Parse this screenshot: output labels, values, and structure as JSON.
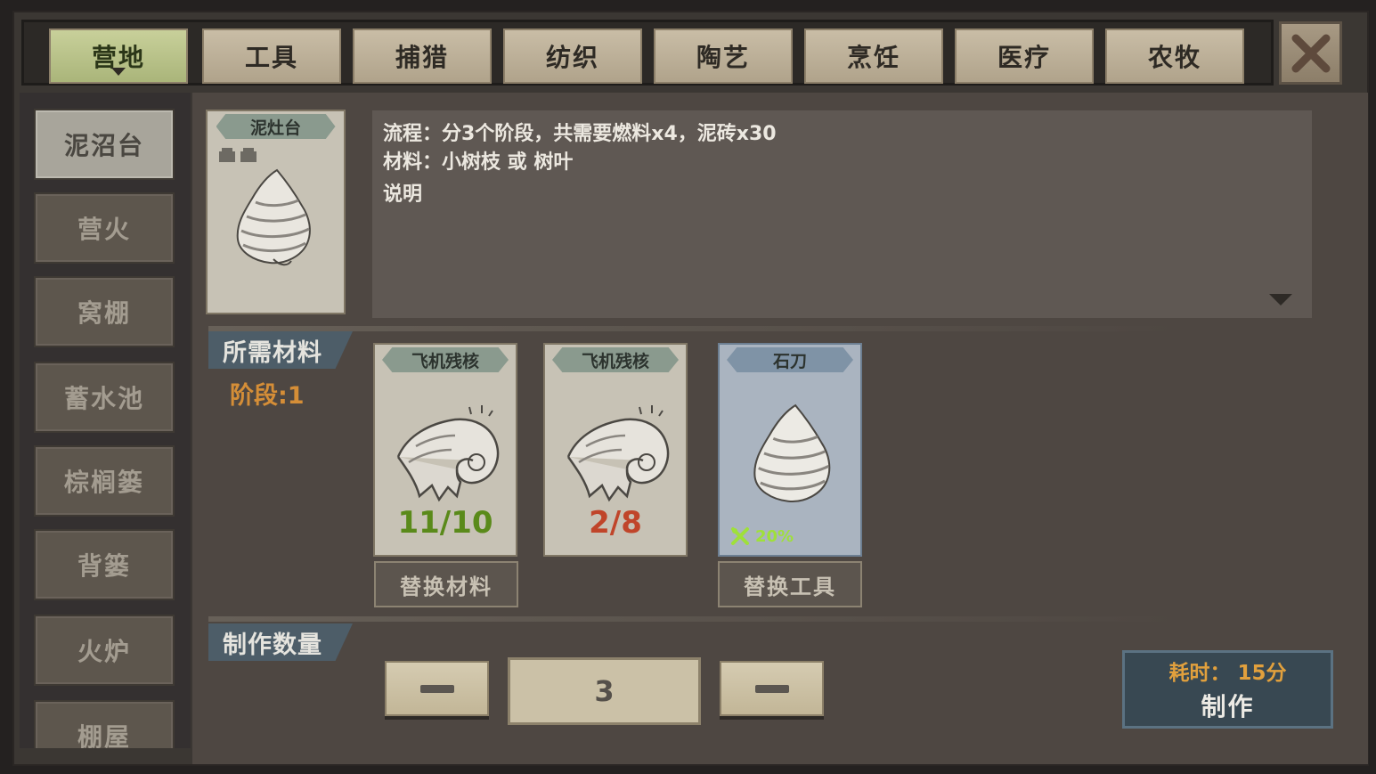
{
  "tabs": [
    {
      "label": "营地",
      "active": true
    },
    {
      "label": "工具",
      "active": false
    },
    {
      "label": "捕猎",
      "active": false
    },
    {
      "label": "纺织",
      "active": false
    },
    {
      "label": "陶艺",
      "active": false
    },
    {
      "label": "烹饪",
      "active": false
    },
    {
      "label": "医疗",
      "active": false
    },
    {
      "label": "农牧",
      "active": false
    }
  ],
  "close_icon": "close-x-icon",
  "sidebar": {
    "items": [
      {
        "label": "泥沼台",
        "active": true
      },
      {
        "label": "营火"
      },
      {
        "label": "窝棚"
      },
      {
        "label": "蓄水池"
      },
      {
        "label": "棕榈篓"
      },
      {
        "label": "背篓"
      },
      {
        "label": "火炉"
      },
      {
        "label": "棚屋"
      }
    ]
  },
  "item_card": {
    "name": "泥灶台",
    "icon": "mud-clay-pile-icon"
  },
  "description": {
    "process": "流程：分3个阶段，共需要燃料x4，泥砖x30",
    "materials": "材料：小树枝 或 树叶",
    "note": "说明"
  },
  "required": {
    "title": "所需材料",
    "stage": "阶段:1",
    "materials": [
      {
        "name": "飞机残核",
        "count": "11/10",
        "count_color": "#5a8a1a",
        "icon": "cloth-roll-icon"
      },
      {
        "name": "飞机残核",
        "count": "2/8",
        "count_color": "#c0452a",
        "icon": "cloth-roll-icon"
      }
    ],
    "tool": {
      "name": "石刀",
      "bonus": "20%",
      "icon": "stone-knife-icon",
      "bonus_icon": "tools-icon"
    },
    "replace_material_label": "替换材料",
    "replace_tool_label": "替换工具"
  },
  "quantity": {
    "title": "制作数量",
    "value": "3"
  },
  "craft": {
    "time": "耗时：  15分",
    "label": "制作"
  }
}
